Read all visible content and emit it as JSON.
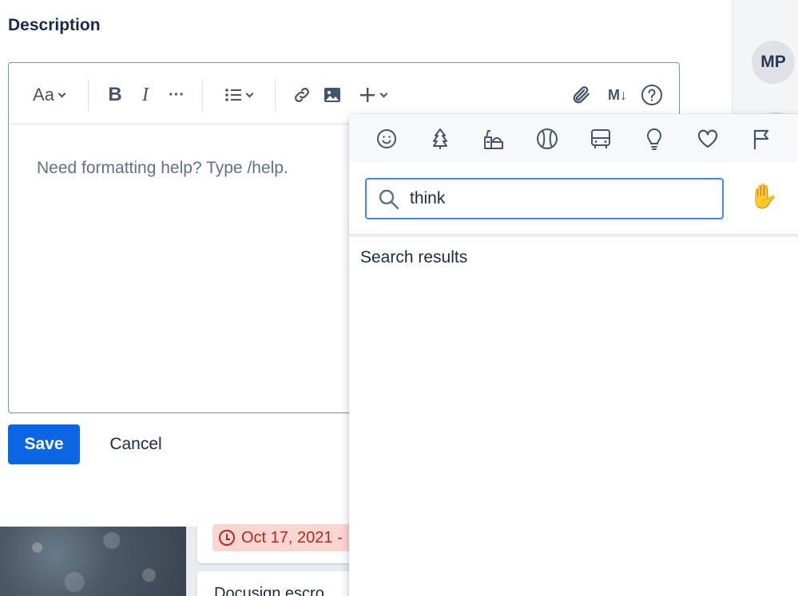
{
  "description": {
    "title": "Description",
    "placeholder": "Need formatting help? Type /help."
  },
  "toolbar": {
    "text_style_label": "Aa",
    "bold_label": "B",
    "italic_label": "I",
    "more_label": "···",
    "markdown_label": "M↓"
  },
  "actions": {
    "save_label": "Save",
    "cancel_label": "Cancel"
  },
  "emoji_picker": {
    "categories": [
      "smileys",
      "nature",
      "food",
      "activity",
      "travel",
      "objects",
      "symbols",
      "flags"
    ],
    "search_value": "think",
    "skin_tone_emoji": "✋",
    "results_label": "Search results"
  },
  "sidebar": {
    "avatar_initials": "MP"
  },
  "background": {
    "card_date": "Oct 17, 2021 -",
    "card_title": "Docusign escro"
  },
  "colors": {
    "primary": "#0c66e4",
    "focus": "#388bff",
    "danger_bg": "#ffd5d2",
    "danger_text": "#ae2a19"
  }
}
